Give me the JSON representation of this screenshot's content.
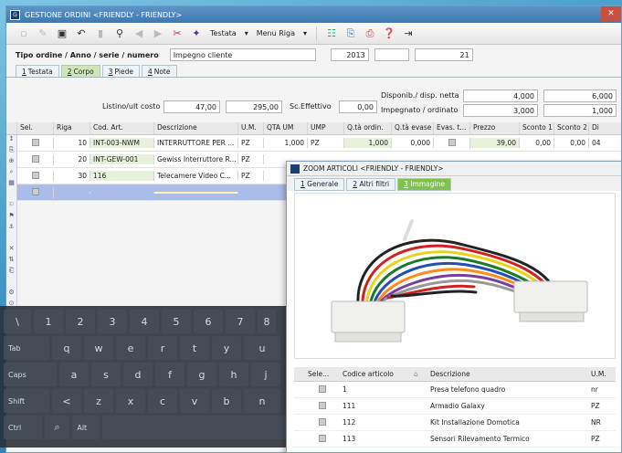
{
  "window": {
    "title": "GESTIONE ORDINI <FRIENDLY - FRIENDLY>",
    "close": "✕",
    "app_icon": "app-icon"
  },
  "toolbar": {
    "testata": "Testata",
    "menu_riga": "Menu Riga",
    "testata_arrow": "▾",
    "menu_arrow": "▾"
  },
  "header": {
    "tipo_label": "Tipo ordine / Anno / serie / numero",
    "tipo_value": "Impegno cliente",
    "anno": "2013",
    "numero": "21"
  },
  "tabs": [
    {
      "n": "1",
      "label": "Testata"
    },
    {
      "n": "2",
      "label": "Corpo"
    },
    {
      "n": "3",
      "label": "Piede"
    },
    {
      "n": "4",
      "label": "Note"
    }
  ],
  "summary": {
    "listino_label": "Listino/ult costo",
    "listino_val": "47,00",
    "ult_costo": "295,00",
    "sc_label": "Sc.Effettivo",
    "sc_val": "0,00",
    "disp_label": "Disponib./ disp. netta",
    "disp_1": "4,000",
    "disp_2": "6,000",
    "imp_label": "Impegnato / ordinato",
    "imp_1": "3,000",
    "imp_2": "1,000"
  },
  "grid": {
    "headers": [
      "Sel.",
      "Riga",
      "Cod. Art.",
      "Descrizione",
      "U.M.",
      "QTA UM",
      "UMP",
      "Q.tà ordin.",
      "Q.tà evase",
      "Evas. t...",
      "Prezzo",
      "Sconto 1",
      "Sconto 2",
      "Di"
    ],
    "rows": [
      {
        "riga": "10",
        "cod": "INT-003-NWM",
        "desc": "INTERRUTTORE PER ...",
        "um": "PZ",
        "qta": "1,000",
        "ump": "PZ",
        "ord": "1,000",
        "eva": "0,000",
        "prezzo": "39,00",
        "sc1": "0,00",
        "sc2": "0,00",
        "di": "04"
      },
      {
        "riga": "20",
        "cod": "INT-GEW-001",
        "desc": "Gewiss Interruttore R...",
        "um": "PZ",
        "qta": "",
        "ump": "",
        "ord": "",
        "eva": "",
        "prezzo": "",
        "sc1": "",
        "sc2": "",
        "di": ""
      },
      {
        "riga": "30",
        "cod": "116",
        "desc": "Telecamere Video C...",
        "um": "PZ",
        "qta": "",
        "ump": "",
        "ord": "",
        "eva": "",
        "prezzo": "",
        "sc1": "",
        "sc2": "",
        "di": ""
      }
    ]
  },
  "keyboard": {
    "rows": [
      [
        "\\",
        "1",
        "2",
        "3",
        "4",
        "5",
        "6",
        "7",
        "8"
      ],
      [
        "Tab",
        "q",
        "w",
        "e",
        "r",
        "t",
        "y",
        "u"
      ],
      [
        "Caps",
        "a",
        "s",
        "d",
        "f",
        "g",
        "h",
        "j"
      ],
      [
        "Shift",
        "<",
        "z",
        "x",
        "c",
        "v",
        "b",
        "n"
      ],
      [
        "Ctrl",
        "⌕",
        "Alt",
        ""
      ]
    ]
  },
  "zoom": {
    "title": "ZOOM ARTICOLI <FRIENDLY - FRIENDLY>",
    "tabs": [
      {
        "n": "1",
        "label": "Generale"
      },
      {
        "n": "2",
        "label": "Altri filtri"
      },
      {
        "n": "3",
        "label": "Immagine"
      }
    ],
    "headers": [
      "Sele...",
      "Codice articolo",
      "Descrizione",
      "U.M."
    ],
    "sort_arrow": "⌂",
    "rows": [
      {
        "cod": "1",
        "desc": "Presa telefono quadro",
        "um": "nr"
      },
      {
        "cod": "111",
        "desc": "Armadio Galaxy",
        "um": "PZ"
      },
      {
        "cod": "112",
        "desc": "Kit Installazione Domotica",
        "um": "NR"
      },
      {
        "cod": "113",
        "desc": "Sensori Rilevamento Termico",
        "um": "PZ"
      }
    ]
  },
  "colors": {
    "accent": "#3f78b0",
    "tab_active": "#cfe6b8",
    "zoom_tab_active": "#7fc24f",
    "new_row": "#aabce8"
  }
}
